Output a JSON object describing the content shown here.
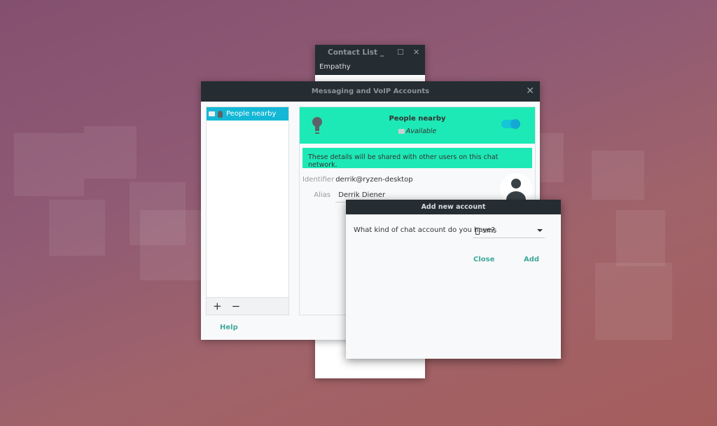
{
  "contact_list": {
    "title": "Contact List",
    "menu": "Empathy",
    "minimize": "_",
    "maximize": "☐",
    "close": "✕"
  },
  "accounts_window": {
    "title": "Messaging and VoIP Accounts",
    "close": "✕",
    "accounts": [
      {
        "label": "People nearby"
      }
    ],
    "add": "+",
    "remove": "−",
    "header": {
      "name": "People nearby",
      "status": "Available",
      "enabled": true
    },
    "banner": "These details will be shared with other users on this chat network.",
    "identifier_label": "Identifier",
    "identifier": "derrik@ryzen-desktop",
    "alias_label": "Alias",
    "alias": "Derrik Diener",
    "help": "Help"
  },
  "add_dialog": {
    "title": "Add new account",
    "question": "What kind of chat account do you have?",
    "selected": "sms",
    "close": "Close",
    "add": "Add"
  },
  "colors": {
    "accent": "#1de9b6",
    "selection": "#14b8d6",
    "link": "#3fa89a",
    "titlebar": "#252d32"
  }
}
